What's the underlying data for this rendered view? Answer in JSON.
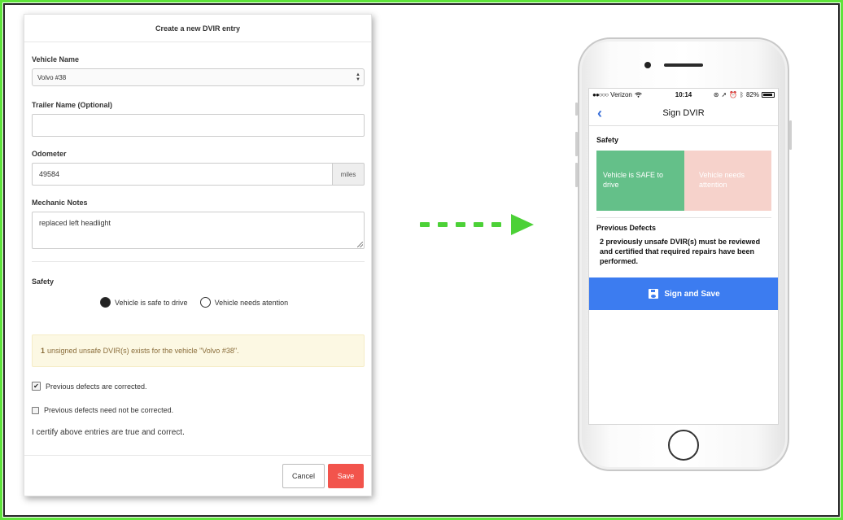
{
  "form": {
    "title": "Create a new DVIR entry",
    "vehicle_label": "Vehicle Name",
    "vehicle_value": "Volvo #38",
    "trailer_label": "Trailer Name (Optional)",
    "trailer_value": "",
    "odometer_label": "Odometer",
    "odometer_value": "49584",
    "odometer_unit": "miles",
    "notes_label": "Mechanic Notes",
    "notes_value": "replaced left headlight",
    "safety_label": "Safety",
    "safety_options": [
      {
        "label": "Vehicle is safe to drive",
        "selected": true
      },
      {
        "label": "Vehicle needs atention",
        "selected": false
      }
    ],
    "warning": {
      "count": "1",
      "text": "unsigned unsafe DVIR(s) exists for the vehicle \"Volvo #38\"."
    },
    "checkboxes": [
      {
        "label": "Previous defects are corrected.",
        "checked": true
      },
      {
        "label": "Previous defects need not be corrected.",
        "checked": false
      }
    ],
    "certify_text": "I certify above entries are true and correct.",
    "cancel_label": "Cancel",
    "save_label": "Save"
  },
  "arrow_color": "#4cd137",
  "phone": {
    "status": {
      "carrier": "Verizon",
      "time": "10:14",
      "battery": "82%"
    },
    "nav_title": "Sign DVIR",
    "safety_label": "Safety",
    "safe_tile": "Vehicle is SAFE to drive",
    "attention_tile": "Vehicle needs attention",
    "prev_title": "Previous Defects",
    "prev_text": "2 previously unsafe DVIR(s) must be reviewed and certified that required repairs have been performed.",
    "sign_button": "Sign and Save"
  },
  "colors": {
    "save_button": "#f2544c",
    "safe_tile": "#64c089",
    "attention_tile": "#f6d2cb",
    "sign_button": "#3c7cf0",
    "warning_bg": "#fcf8e3",
    "frame": "#5ee33b"
  }
}
